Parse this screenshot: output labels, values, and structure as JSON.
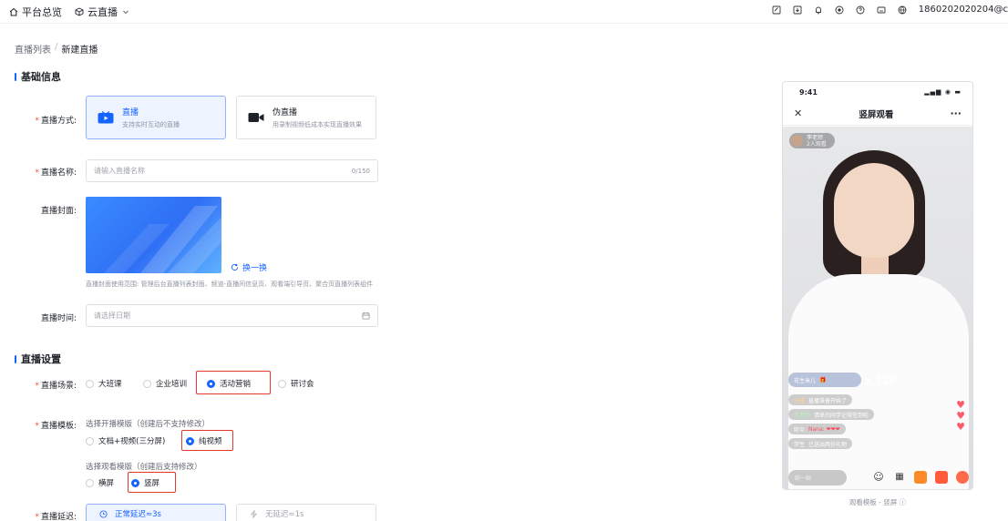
{
  "topbar": {
    "nav": [
      {
        "icon": "home-icon",
        "label": "平台总览"
      },
      {
        "icon": "cube-icon",
        "label": "云直播"
      }
    ],
    "account": "1860202020204@c"
  },
  "breadcrumb": {
    "parent": "直播列表",
    "sep": "/",
    "current": "新建直播"
  },
  "basic": {
    "title": "基础信息",
    "mode_label": "直播方式:",
    "mode_options": [
      {
        "title": "直播",
        "desc": "支持实时互动的直播",
        "active": true
      },
      {
        "title": "伪直播",
        "desc": "用录制视频低成本实现直播效果",
        "active": false
      }
    ],
    "name_label": "直播名称:",
    "name_placeholder": "请输入直播名称",
    "name_count": "0/150",
    "cover_label": "直播封面:",
    "cover_swap": "换一换",
    "cover_hint": "直播封面使用范围: 管理后台直播列表封面、频道-直播间信息页、观看端引导页、聚合页直播列表组件",
    "time_label": "直播时间:",
    "time_placeholder": "请选择日期"
  },
  "settings": {
    "title": "直播设置",
    "scene_label": "直播场景:",
    "scene_options": [
      "大班课",
      "企业培训",
      "活动营销",
      "研讨会"
    ],
    "scene_selected": "活动营销",
    "template_label": "直播模板:",
    "open_template_hint": "选择开播模版（创建后不支持修改）",
    "open_template_options": [
      "文档+视频(三分屏)",
      "纯视频"
    ],
    "open_template_selected": "纯视频",
    "watch_template_hint": "选择观看模版（创建后支持修改）",
    "watch_template_options": [
      "横屏",
      "竖屏"
    ],
    "watch_template_selected": "竖屏",
    "delay_label": "直播延迟:",
    "delay_options": [
      "正常延迟≈3s",
      "无延迟≈1s"
    ]
  },
  "preview": {
    "time": "9:41",
    "title": "竖屏观看",
    "host_name": "李老师",
    "host_sub": "2人观看",
    "gift_count": "x 126",
    "gift_user": "花生米儿",
    "gift_sub": "送你爱心",
    "chat": [
      "直播准备开始了",
      "请来的同学记得签到啦",
      "Nana: ❤❤❤",
      "已送出两份礼物"
    ],
    "chat_users": [
      "主播",
      "王老师",
      "听众",
      "学生"
    ],
    "input_placeholder": "聊一聊",
    "caption": "观看模板 - 竖屏 ⓘ"
  },
  "colors": {
    "accent": "#1664ff",
    "highlight": "#e0382b"
  }
}
